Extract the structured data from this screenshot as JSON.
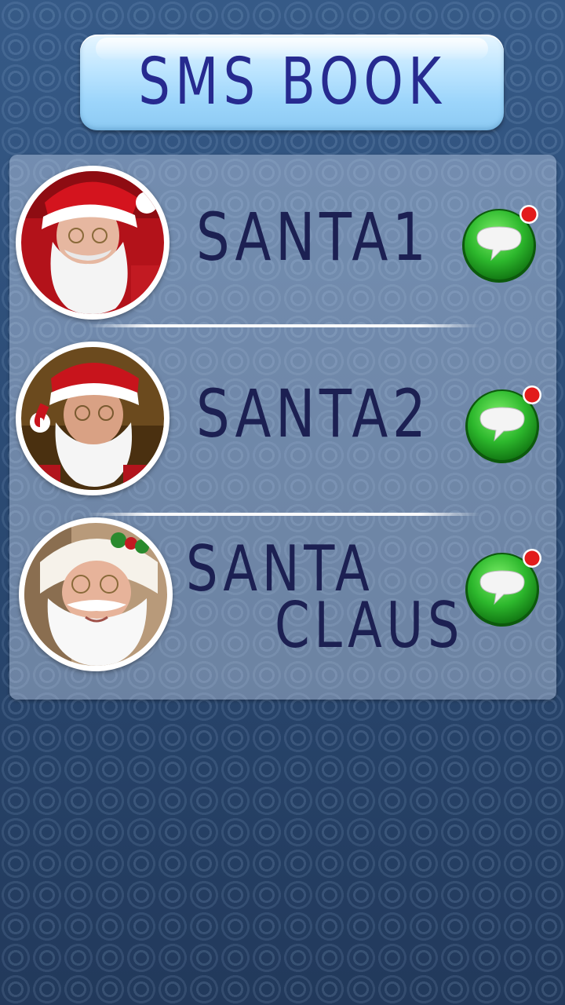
{
  "header": {
    "title": "SMS BOOK"
  },
  "contacts": [
    {
      "name": "SANTA1",
      "avatar_icon": "santa-portrait",
      "action_icon": "sms-bubble-icon",
      "has_notification": true
    },
    {
      "name": "SANTA2",
      "avatar_icon": "santa-portrait",
      "action_icon": "sms-bubble-icon",
      "has_notification": true
    },
    {
      "name_line_1": "SANTA",
      "name_line_2": "CLAUS",
      "avatar_icon": "santa-portrait",
      "action_icon": "sms-bubble-icon",
      "has_notification": true
    }
  ],
  "colors": {
    "background": "#2a4872",
    "header": "#9cd5fb",
    "title_text": "#262a8f",
    "name_text": "#1c2052",
    "sms_green": "#2db82d",
    "notification_dot": "#e21b1b"
  }
}
